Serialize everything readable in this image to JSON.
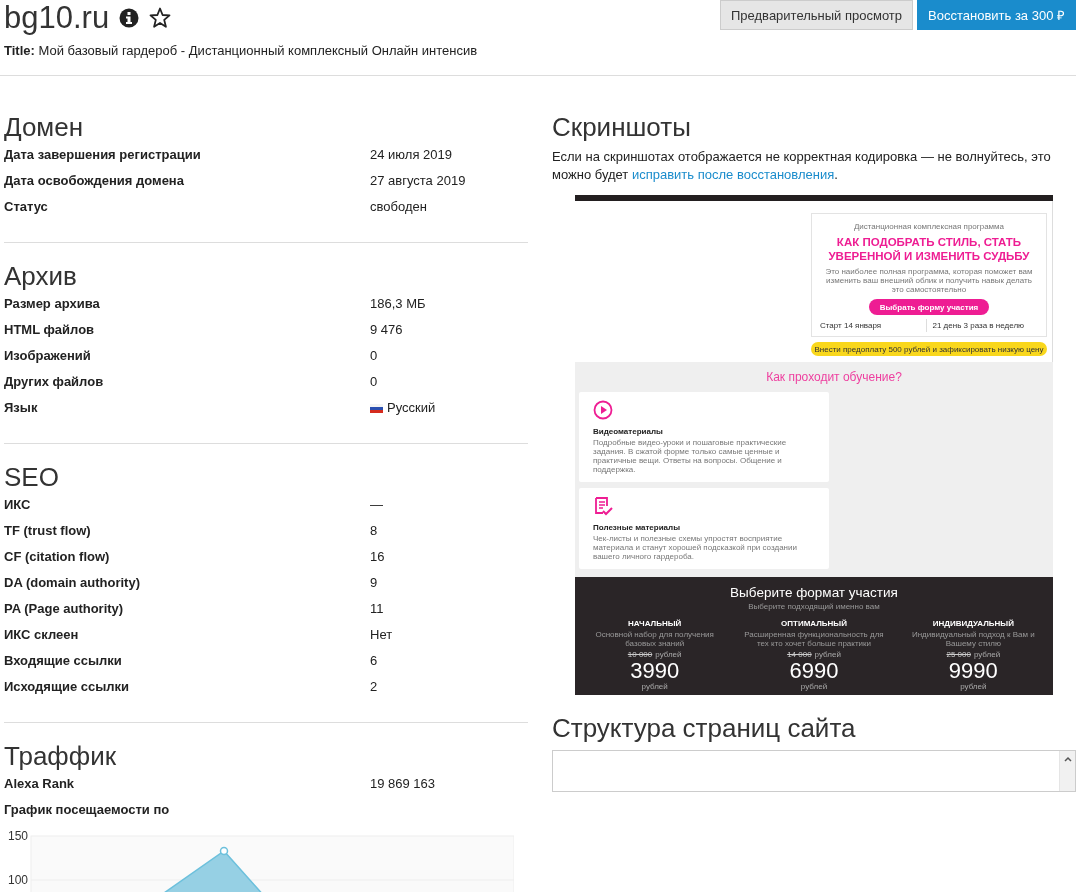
{
  "header": {
    "domain": "bg10.ru",
    "title": "**Title:** Мой базовый гардероб - Дистанционный комплексный Онлайн интенсив"
  },
  "buttons": [
    {
      "label": "Предварительный просмотр",
      "kind": "secondary"
    },
    {
      "label": "Восстановить за 300 ₽",
      "kind": "primary"
    }
  ],
  "sections": [
    {
      "heading": "Домен",
      "rows": [
        {
          "label": "Дата завершения регистрации",
          "value": "24 июля 2019",
          "kind": "text"
        },
        {
          "label": "Дата освобождения домена",
          "value": "27 августа 2019",
          "kind": "text"
        },
        {
          "label": "Статус",
          "value": "свободен",
          "kind": "text"
        }
      ]
    },
    {
      "heading": "Архив",
      "rows": [
        {
          "label": "Размер архива",
          "value": "186,3 МБ",
          "kind": "text"
        },
        {
          "label": "HTML файлов",
          "value": "9 476",
          "kind": "text"
        },
        {
          "label": "Изображений",
          "value": "0",
          "kind": "text"
        },
        {
          "label": "Других файлов",
          "value": "0",
          "kind": "text"
        },
        {
          "label": "Язык",
          "value": "Русский",
          "kind": "language"
        }
      ]
    },
    {
      "heading": "SEO",
      "rows": [
        {
          "label": "ИКС",
          "value": "—",
          "kind": "text"
        },
        {
          "label": "TF (trust flow)",
          "value": "8",
          "kind": "text"
        },
        {
          "label": "CF (citation flow)",
          "value": "16",
          "kind": "text"
        },
        {
          "label": "DA (domain authority)",
          "value": "9",
          "kind": "text"
        },
        {
          "label": "PA (Page authority)",
          "value": "11",
          "kind": "text"
        },
        {
          "label": "ИКС склеен",
          "value": "Нет",
          "kind": "text"
        },
        {
          "label": "Входящие ссылки",
          "value": "6",
          "kind": "text"
        },
        {
          "label": "Исходящие ссылки",
          "value": "2",
          "kind": "text"
        }
      ]
    },
    {
      "heading": "Траффик",
      "rows": [
        {
          "label": "Alexa Rank",
          "value": "19 869 163",
          "kind": "text"
        },
        {
          "label": "График посещаемости по",
          "kind": "text"
        }
      ],
      "chart": {
        "axis_labels": [
          "150",
          "100"
        ]
      }
    }
  ],
  "screenshots": {
    "heading": "Скриншоты",
    "text": "Если на скриншотах отображается не корректная кодировка — не волнуйтесь, это можно будет ",
    "link": "исправить после восстановления",
    "text_after": "."
  },
  "preview": {
    "hero": {
      "subtitle": "Дистанционная комплексная программа",
      "headline": "КАК ПОДОБРАТЬ СТИЛЬ, СТАТЬ УВЕРЕННОЙ И ИЗМЕНИТЬ СУДЬБУ",
      "description": "Это наиболее полная программа, которая поможет вам изменить ваш внешний облик и получить навык делать это самостоятельно",
      "button": "Выбрать форму участия",
      "start": "Старт 14 января",
      "schedule": "21 день 3 раза в неделю",
      "prepay_button": "Внести предоплату 500 рублей и зафиксировать низкую цену"
    },
    "learning": {
      "heading": "Как проходит обучение?",
      "features": [
        {
          "title": "Видеоматериалы",
          "text": "Подробные видео-уроки и пошаговые практические задания. В сжатой форме только самые ценные и практичные вещи. Ответы на вопросы. Общение и поддержка."
        },
        {
          "title": "Полезные материалы",
          "text": "Чек-листы и полезные схемы упростят восприятие материала и станут хорошей подсказкой при создании вашего личного гардероба."
        }
      ]
    },
    "pricing": {
      "heading": "Выберите формат участия",
      "subtitle": "Выберите подходящий именно вам",
      "plans": [
        {
          "name": "НАЧАЛЬНЫЙ",
          "description": "Основной набор для получения базовых знаний",
          "old_price": "10 000",
          "old_unit": "рублей",
          "price": "3990",
          "unit": "рублей"
        },
        {
          "name": "ОПТИМАЛЬНЫЙ",
          "description": "Расширенная функциональность для тех кто хочет больше практики",
          "old_price": "14 000",
          "old_unit": "рублей",
          "price": "6990",
          "unit": "рублей"
        },
        {
          "name": "ИНДИВИДУАЛЬНЫЙ",
          "description": "Индивидуальный подход к Вам и Вашему стилю",
          "old_price": "25 000",
          "old_unit": "рублей",
          "price": "9990",
          "unit": "рублей"
        }
      ]
    }
  },
  "structure": {
    "heading": "Структура страниц сайта"
  }
}
